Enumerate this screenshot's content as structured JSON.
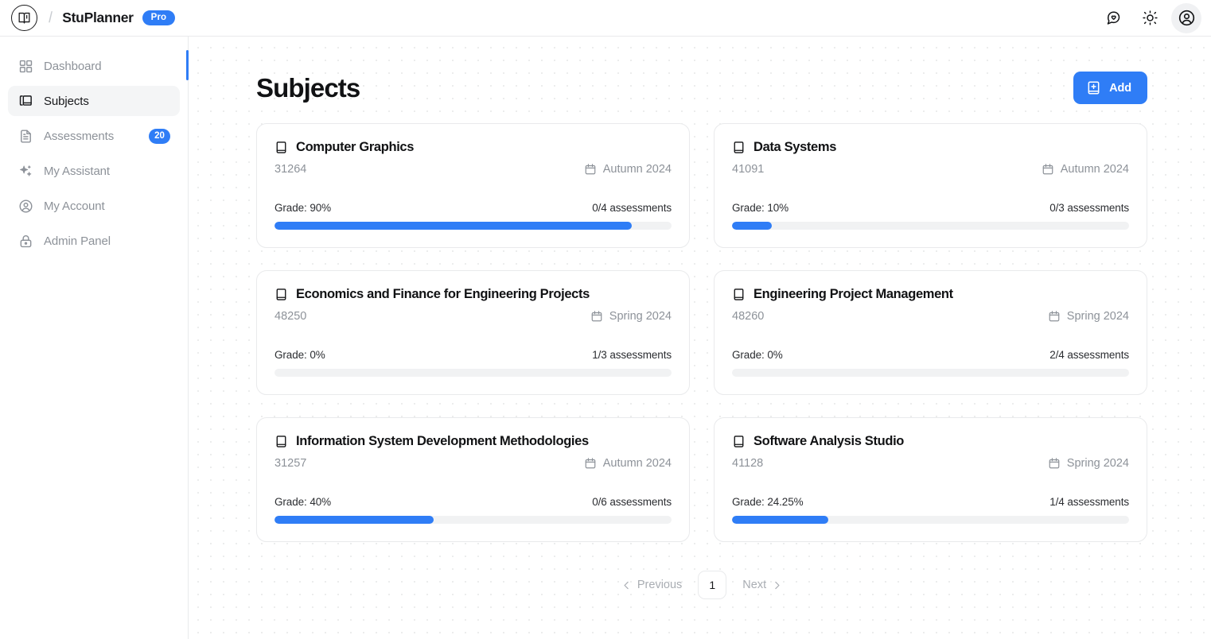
{
  "topbar": {
    "logo_icon": "book-logo-icon",
    "separator": "/",
    "brand": "StuPlanner",
    "plan_badge": "Pro",
    "actions": [
      {
        "name": "feedback-icon",
        "label": "message-heart-icon"
      },
      {
        "name": "theme-toggle-icon",
        "label": "sun-icon"
      },
      {
        "name": "account-avatar-icon",
        "label": "user-circle-icon"
      }
    ]
  },
  "sidebar": {
    "items": [
      {
        "label": "Dashboard",
        "icon": "grid-icon",
        "active": false,
        "badge": ""
      },
      {
        "label": "Subjects",
        "icon": "books-icon",
        "active": true,
        "badge": ""
      },
      {
        "label": "Assessments",
        "icon": "document-icon",
        "active": false,
        "badge": "20"
      },
      {
        "label": "My Assistant",
        "icon": "sparkles-icon",
        "active": false,
        "badge": ""
      },
      {
        "label": "My Account",
        "icon": "user-circle-icon",
        "active": false,
        "badge": ""
      },
      {
        "label": "Admin Panel",
        "icon": "lock-icon",
        "active": false,
        "badge": ""
      }
    ]
  },
  "main": {
    "title": "Subjects",
    "add_button": "Add",
    "accent_color": "#2f7df6",
    "cards": [
      {
        "title": "Computer Graphics",
        "code": "31264",
        "term": "Autumn 2024",
        "grade_label": "Grade: 90%",
        "grade_value": 90,
        "assessments_label": "0/4 assessments"
      },
      {
        "title": "Data Systems",
        "code": "41091",
        "term": "Autumn 2024",
        "grade_label": "Grade: 10%",
        "grade_value": 10,
        "assessments_label": "0/3 assessments"
      },
      {
        "title": "Economics and Finance for Engineering Projects",
        "code": "48250",
        "term": "Spring 2024",
        "grade_label": "Grade: 0%",
        "grade_value": 0,
        "assessments_label": "1/3 assessments"
      },
      {
        "title": "Engineering Project Management",
        "code": "48260",
        "term": "Spring 2024",
        "grade_label": "Grade: 0%",
        "grade_value": 0,
        "assessments_label": "2/4 assessments"
      },
      {
        "title": "Information System Development Methodologies",
        "code": "31257",
        "term": "Autumn 2024",
        "grade_label": "Grade: 40%",
        "grade_value": 40,
        "assessments_label": "0/6 assessments"
      },
      {
        "title": "Software Analysis Studio",
        "code": "41128",
        "term": "Spring 2024",
        "grade_label": "Grade: 24.25%",
        "grade_value": 24.25,
        "assessments_label": "1/4 assessments"
      }
    ],
    "pagination": {
      "previous": "Previous",
      "current_page": "1",
      "next": "Next"
    }
  }
}
